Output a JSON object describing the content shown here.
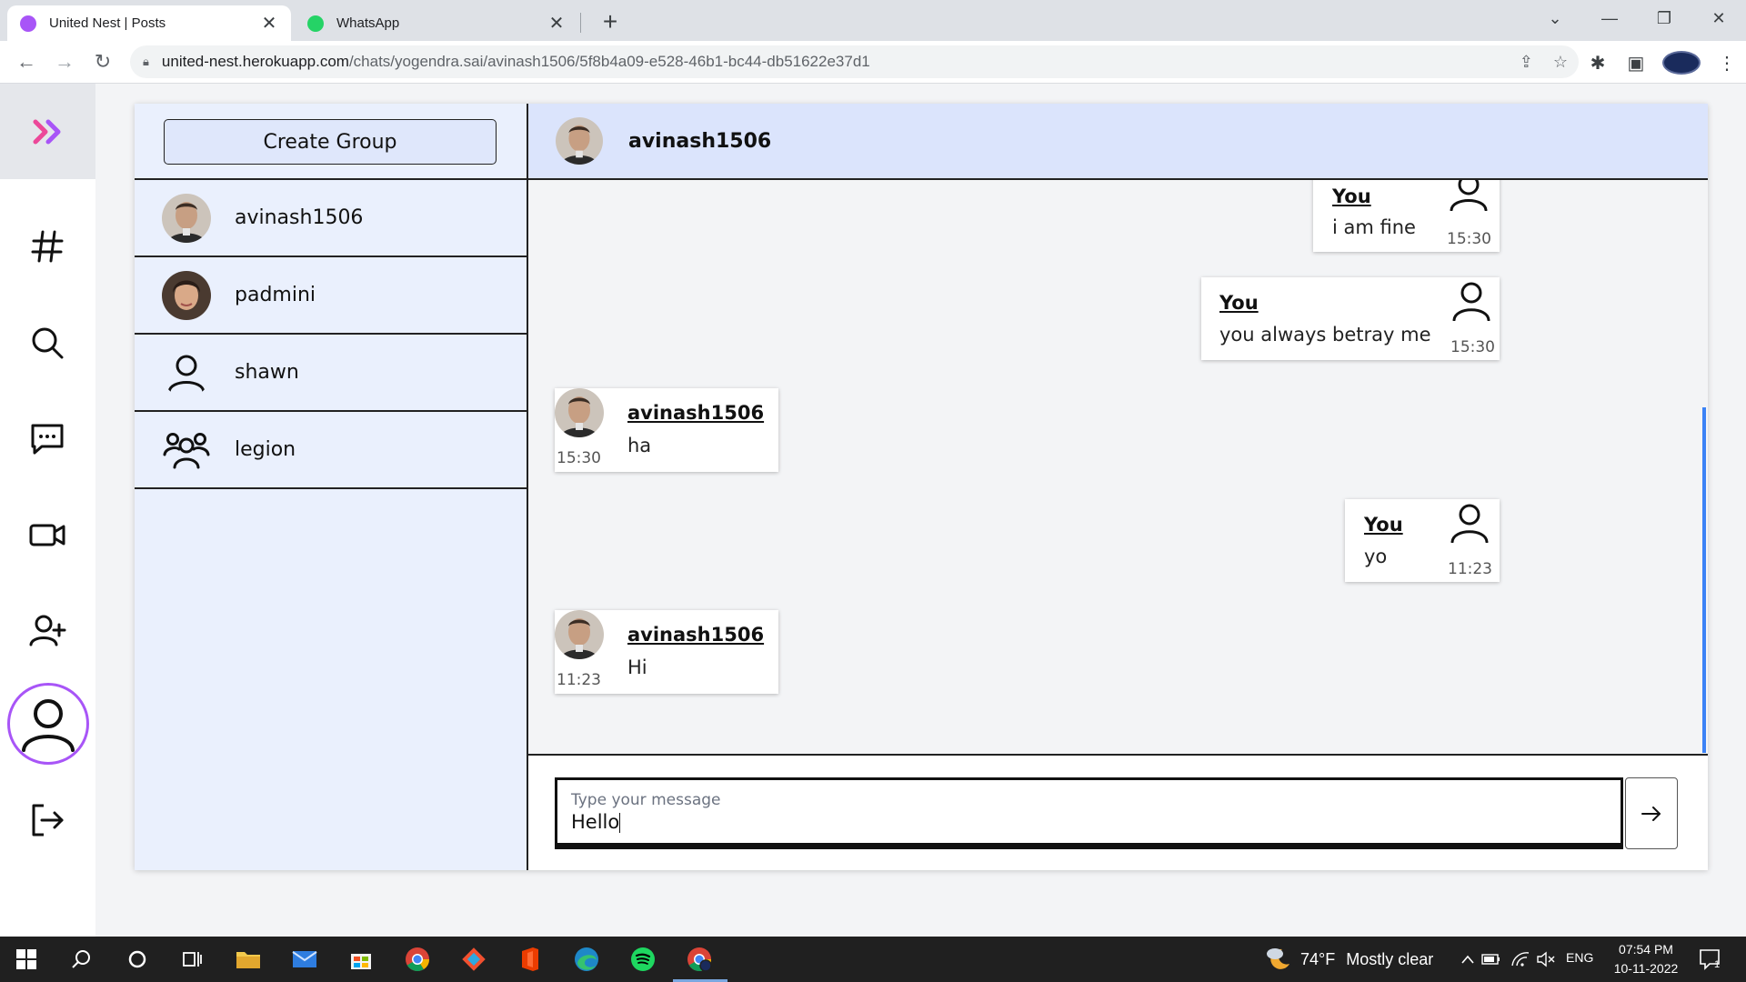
{
  "browser": {
    "tabs": [
      {
        "title": "United Nest | Posts",
        "favicon_color": "#a855f7"
      },
      {
        "title": "WhatsApp",
        "favicon_color": "#25d366"
      }
    ],
    "url_host": "united-nest.herokuapp.com",
    "url_path": "/chats/yogendra.sai/avinash1506/5f8b4a09-e528-46b1-bc44-db51622e37d1"
  },
  "nav": {
    "items": [
      "hashtag-icon",
      "search-icon",
      "chat-icon",
      "video-icon",
      "add-user-icon",
      "profile-icon",
      "logout-icon"
    ],
    "accent": "#a855f7"
  },
  "contacts": {
    "create_group_label": "Create Group",
    "list": [
      {
        "name": "avinash1506",
        "avatar": "photo-man"
      },
      {
        "name": "padmini",
        "avatar": "photo-woman"
      },
      {
        "name": "shawn",
        "avatar": "user-icon"
      },
      {
        "name": "legion",
        "avatar": "group-icon"
      }
    ]
  },
  "chat": {
    "header_name": "avinash1506",
    "messages": [
      {
        "sender": "You",
        "text": "i am fine",
        "time": "15:30",
        "side": "right"
      },
      {
        "sender": "You",
        "text": "you always betray me",
        "time": "15:30",
        "side": "right"
      },
      {
        "sender": "avinash1506",
        "text": "ha",
        "time": "15:30",
        "side": "left"
      },
      {
        "sender": "You",
        "text": "yo",
        "time": "11:23",
        "side": "right"
      },
      {
        "sender": "avinash1506",
        "text": "Hi",
        "time": "11:23",
        "side": "left"
      }
    ],
    "composer": {
      "placeholder": "Type your message",
      "value": "Hello"
    }
  },
  "taskbar": {
    "weather_temp": "74°F",
    "weather_text": "Mostly clear",
    "lang": "ENG",
    "time": "07:54 PM",
    "date": "10-11-2022",
    "notif_count": "1"
  }
}
